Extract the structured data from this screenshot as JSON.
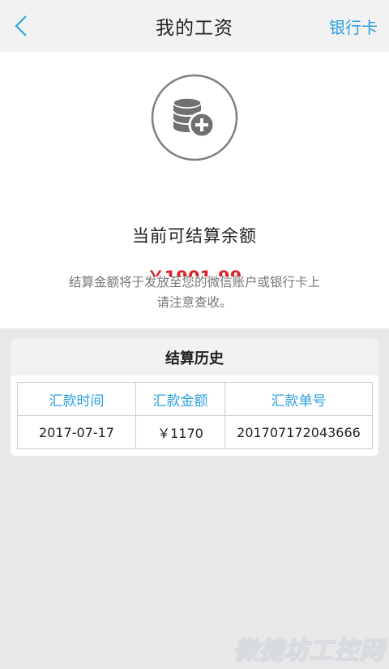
{
  "nav": {
    "back_icon": "chevron-left-icon",
    "title": "我的工资",
    "right_label": "银行卡"
  },
  "summary": {
    "icon": "coins-plus-icon",
    "label": "当前可结算余额",
    "amount": "￥1901.99",
    "note_line1": "结算金额将于发放至您的微信账户或银行卡上",
    "note_line2": "请注意查收。"
  },
  "history": {
    "title": "结算历史",
    "columns": [
      "汇款时间",
      "汇款金额",
      "汇款单号"
    ],
    "rows": [
      [
        "2017-07-17",
        "￥1170",
        "201707172043666"
      ]
    ]
  },
  "watermark": "微捷坊工控网",
  "colors": {
    "accent": "#2aa0e2",
    "amount_red": "#d8232a",
    "background": "#e8e8e8"
  }
}
